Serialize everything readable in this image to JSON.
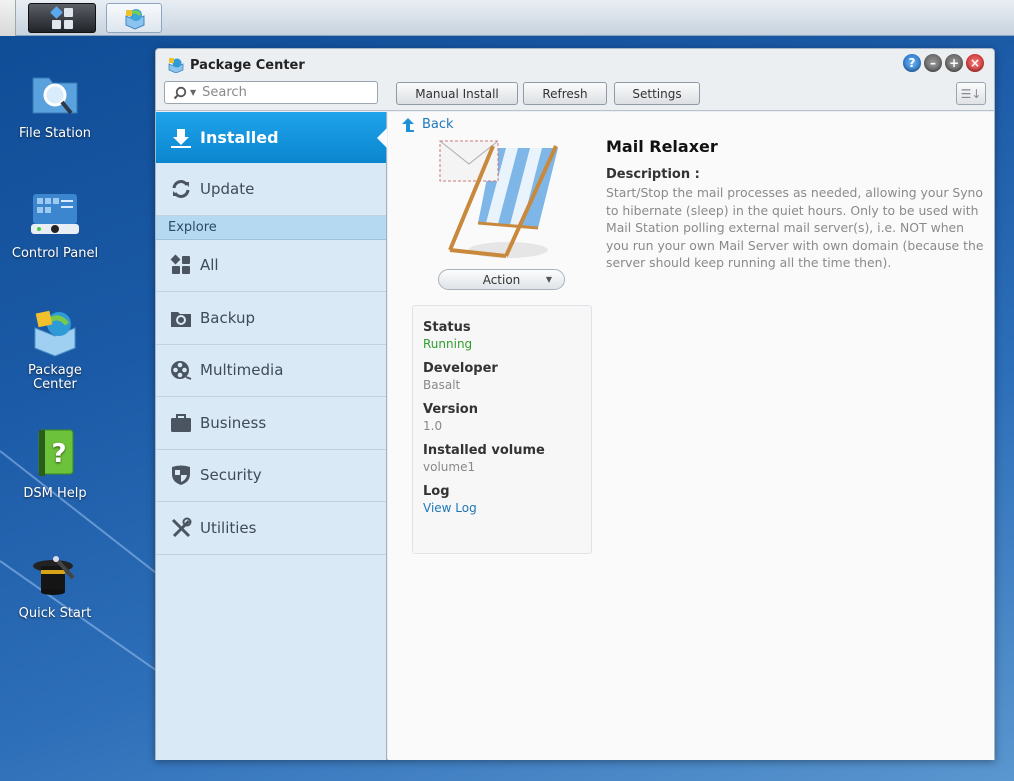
{
  "taskbar": {
    "main_menu_icon": "main-menu-grid-icon",
    "open_app_icon": "package-center-icon"
  },
  "desktop": {
    "icons": [
      {
        "label": "File Station",
        "icon": "file-station-icon"
      },
      {
        "label": "Control Panel",
        "icon": "control-panel-icon"
      },
      {
        "label": "Package Center",
        "icon": "package-center-icon"
      },
      {
        "label": "DSM Help",
        "icon": "help-book-icon"
      },
      {
        "label": "Quick Start",
        "icon": "magic-hat-icon"
      }
    ]
  },
  "window": {
    "title": "Package Center",
    "controls": {
      "help": "?",
      "minimize": "–",
      "maximize": "+",
      "close": "×"
    },
    "search": {
      "placeholder": "Search",
      "value": ""
    },
    "toolbar": {
      "manual_install": "Manual Install",
      "refresh": "Refresh",
      "settings": "Settings"
    },
    "sidebar": {
      "top_items": [
        {
          "label": "Installed",
          "icon": "download-icon",
          "active": true
        },
        {
          "label": "Update",
          "icon": "refresh-icon",
          "active": false
        }
      ],
      "section_label": "Explore",
      "explore_items": [
        {
          "label": "All",
          "icon": "grid-icon"
        },
        {
          "label": "Backup",
          "icon": "backup-icon"
        },
        {
          "label": "Multimedia",
          "icon": "film-reel-icon"
        },
        {
          "label": "Business",
          "icon": "briefcase-icon"
        },
        {
          "label": "Security",
          "icon": "shield-icon"
        },
        {
          "label": "Utilities",
          "icon": "tools-icon"
        }
      ]
    },
    "detail": {
      "back_label": "Back",
      "action_label": "Action",
      "package_name": "Mail Relaxer",
      "description_label": "Description :",
      "description": "Start/Stop the mail processes as needed, allowing your Syno to hibernate (sleep) in the quiet hours. Only to be used with Mail Station polling external mail server(s), i.e. NOT when you run your own Mail Server with own domain (because the server should keep running all the time then).",
      "info": {
        "status_label": "Status",
        "status_value": "Running",
        "developer_label": "Developer",
        "developer_value": "Basalt",
        "version_label": "Version",
        "version_value": "1.0",
        "volume_label": "Installed volume",
        "volume_value": "volume1",
        "log_label": "Log",
        "log_link": "View Log"
      }
    }
  },
  "colors": {
    "accent": "#0a86cf",
    "status_running": "#2e9e2e",
    "link": "#2178b8"
  }
}
